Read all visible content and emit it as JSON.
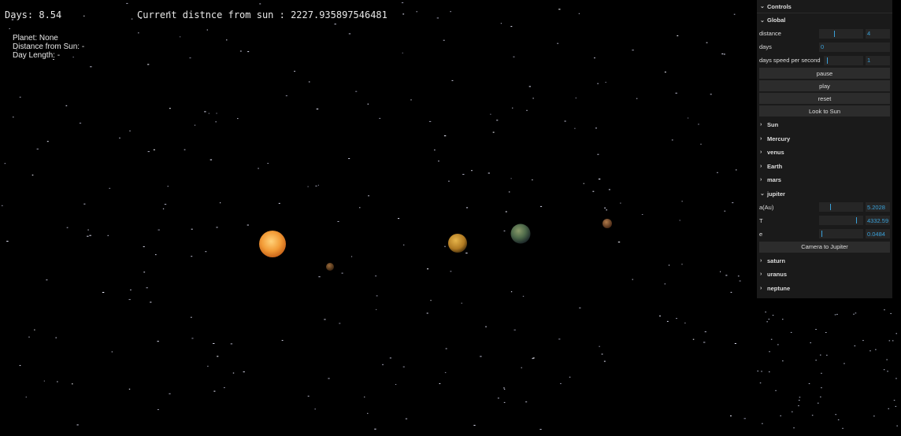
{
  "hud": {
    "days": "Days: 8.54",
    "distance": "Current distnce from sun : 2227.935897546481",
    "planet": "Planet: None",
    "distance_from_sun": "Distance from Sun: -",
    "day_length": "Day Length: -"
  },
  "gui": {
    "title": "Controls",
    "global": {
      "title": "Global",
      "distance_label": "distance",
      "distance_value": "4",
      "distance_level": 0.35,
      "days_label": "days",
      "days_value": "0",
      "speed_label": "days speed per second",
      "speed_value": "1",
      "speed_level": 0.08,
      "pause": "pause",
      "play": "play",
      "reset": "reset",
      "look_sun": "Look to Sun"
    },
    "folders_before": [
      "Sun",
      "Mercury",
      "venus",
      "Earth",
      "mars"
    ],
    "jupiter": {
      "title": "jupiter",
      "a_label": "a(Au)",
      "a_value": "5.2028",
      "a_level": 0.25,
      "t_label": "T",
      "t_value": "4332.59",
      "t_level": 0.87,
      "e_label": "e",
      "e_value": "0.0484",
      "e_level": 0.05,
      "camera_button": "Camera to Jupiter"
    },
    "folders_after": [
      "saturn",
      "uranus",
      "neptune"
    ]
  },
  "colors": {
    "panel_bg": "#1a1a1a",
    "field_bg": "#262626",
    "accent": "#3aa0d8",
    "sun": "#f5a742",
    "venus": "#c98b2e",
    "earth": "#5f6f4f"
  }
}
